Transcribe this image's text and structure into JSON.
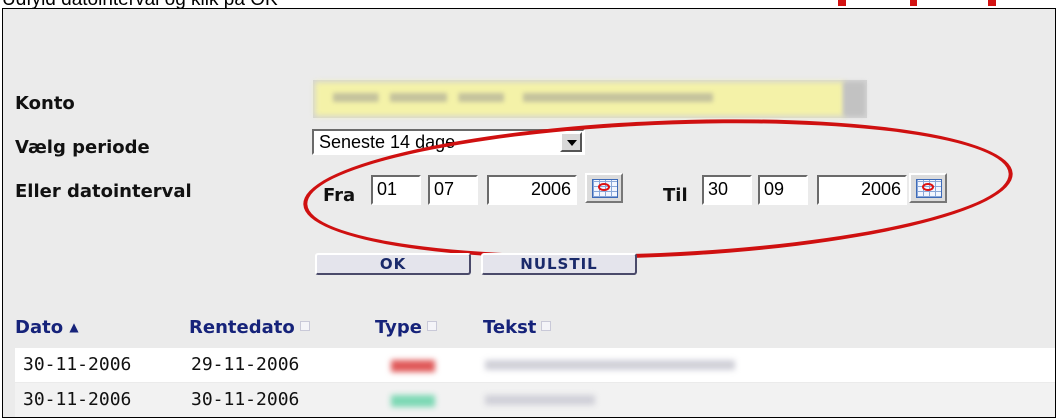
{
  "caption": {
    "text": "Udfyld datointerval og klik på OK"
  },
  "form": {
    "account_label": "Konto",
    "period_label": "Vælg periode",
    "period_selected": "Seneste 14 dage",
    "interval_label": "Eller datointerval",
    "from_label": "Fra",
    "from": {
      "day": "01",
      "month": "07",
      "year": "2006"
    },
    "to_label": "Til",
    "to": {
      "day": "30",
      "month": "09",
      "year": "2006"
    },
    "ok_button": "OK",
    "reset_button": "NULSTIL"
  },
  "table": {
    "columns": [
      "Dato",
      "Rentedato",
      "Type",
      "Tekst"
    ],
    "sort_indicator": "▲",
    "rows": [
      {
        "dato": "30-11-2006",
        "rentedato": "29-11-2006",
        "type_color": "#e05a5a"
      },
      {
        "dato": "30-11-2006",
        "rentedato": "30-11-2006",
        "type_color": "#7dd8b4"
      }
    ]
  },
  "colors": {
    "annotation": "#cf1010",
    "header_text": "#16237a",
    "account_field": "#f4f2a8"
  },
  "icons": [
    "calendar-icon",
    "dropdown-arrow-icon",
    "sort-ascending-icon",
    "sort-icon"
  ]
}
